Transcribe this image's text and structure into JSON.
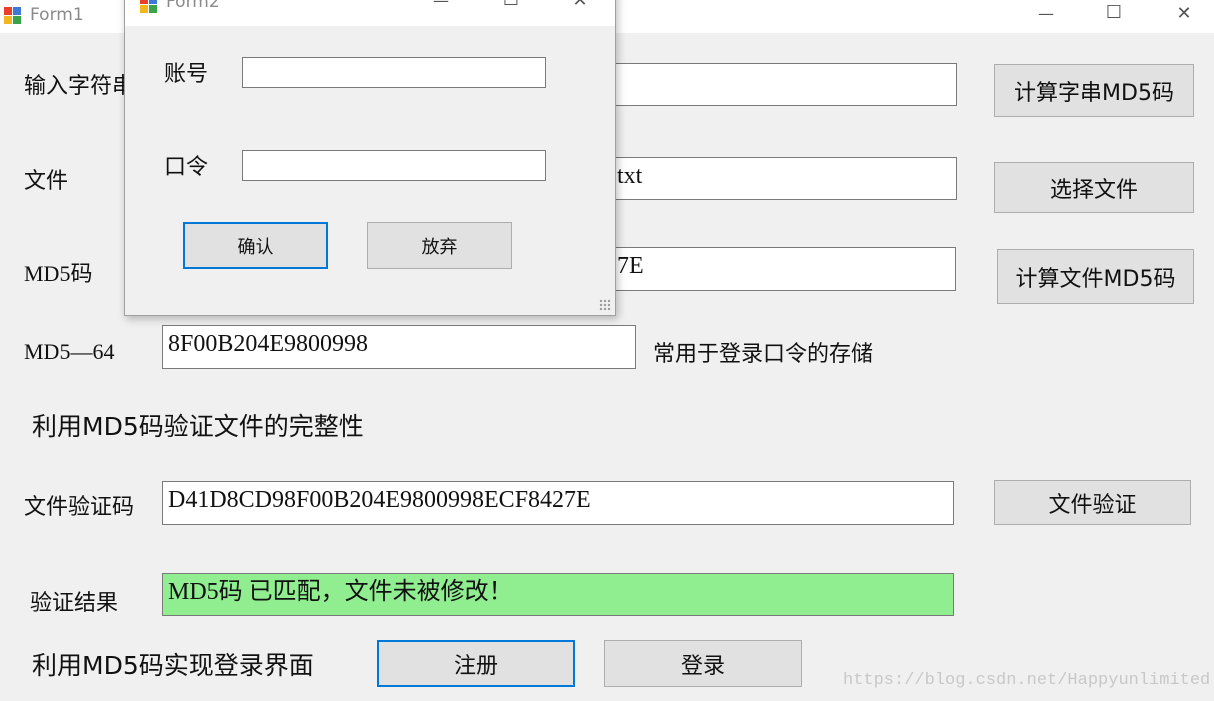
{
  "form1": {
    "title": "Form1",
    "controls": {
      "minimize": "—",
      "maximize": "☐",
      "close": "✕"
    },
    "labels": {
      "input_string": "输入字符串",
      "file": "文件",
      "md5": "MD5码",
      "md5_64": "MD5—64",
      "md5_64_note": "常用于登录口令的存储",
      "verify_section": "利用MD5码验证文件的完整性",
      "file_verify_code": "文件验证码",
      "verify_result": "验证结果",
      "login_section": "利用MD5码实现登录界面"
    },
    "fields": {
      "input_string": "",
      "file": "txt",
      "md5": "7E",
      "md5_64": "8F00B204E9800998",
      "file_verify_code": "D41D8CD98F00B204E9800998ECF8427E",
      "verify_result": "MD5码 已匹配，文件未被修改！"
    },
    "buttons": {
      "calc_string_md5": "计算字串MD5码",
      "select_file": "选择文件",
      "calc_file_md5": "计算文件MD5码",
      "file_verify": "文件验证",
      "register": "注册",
      "login": "登录"
    },
    "watermark": "https://blog.csdn.net/Happyunlimited"
  },
  "form2": {
    "title": "Form2",
    "controls": {
      "minimize": "—",
      "maximize": "☐",
      "close": "✕"
    },
    "labels": {
      "account": "账号",
      "password": "口令"
    },
    "fields": {
      "account": "",
      "password": ""
    },
    "buttons": {
      "confirm": "确认",
      "cancel": "放弃"
    }
  },
  "colors": {
    "result_bg": "#90ee90",
    "focus_border": "#0078d7",
    "window_bg": "#f0f0f0"
  }
}
